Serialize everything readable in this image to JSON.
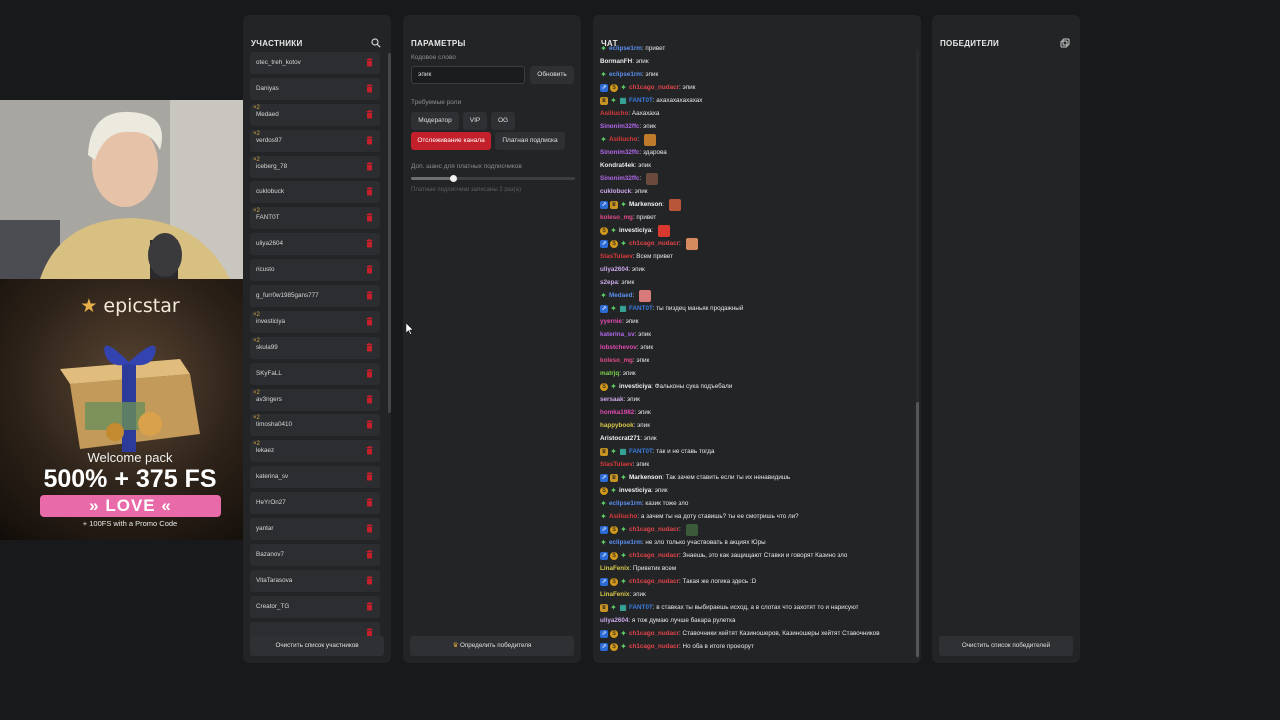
{
  "participants": {
    "title": "УЧАСТНИКИ",
    "list": [
      {
        "name": "otec_treh_kotov",
        "bonus": ""
      },
      {
        "name": "Daniyas",
        "bonus": ""
      },
      {
        "name": "Medaed",
        "bonus": "×2"
      },
      {
        "name": "verdos97",
        "bonus": "×2"
      },
      {
        "name": "iceberg_78",
        "bonus": "×2"
      },
      {
        "name": "cuklobuck",
        "bonus": ""
      },
      {
        "name": "FANT0T",
        "bonus": "×2"
      },
      {
        "name": "uliya2604",
        "bonus": ""
      },
      {
        "name": "ricusto",
        "bonus": ""
      },
      {
        "name": "g_furr0w1985gans777",
        "bonus": ""
      },
      {
        "name": "investiciya",
        "bonus": "×2"
      },
      {
        "name": "skula99",
        "bonus": "×2"
      },
      {
        "name": "SKyFaLL",
        "bonus": ""
      },
      {
        "name": "av3ngers",
        "bonus": "×2"
      },
      {
        "name": "timosha0410",
        "bonus": "×2"
      },
      {
        "name": "lekaez",
        "bonus": "×2"
      },
      {
        "name": "katerina_sv",
        "bonus": ""
      },
      {
        "name": "HeYrOn27",
        "bonus": ""
      },
      {
        "name": "yantar",
        "bonus": ""
      },
      {
        "name": "Bazanov7",
        "bonus": ""
      },
      {
        "name": "VitaTarasova",
        "bonus": ""
      },
      {
        "name": "Creator_TG",
        "bonus": ""
      },
      {
        "name": "",
        "bonus": ""
      }
    ],
    "clear_label": "Очистить список участников"
  },
  "params": {
    "title": "ПАРАМЕТРЫ",
    "keyword_label": "Кодовое слово",
    "keyword_value": "эпик",
    "update_label": "Обновить",
    "roles_label": "Требуемые роли",
    "roles": [
      "Модератор",
      "VIP",
      "OG"
    ],
    "follow_label": "Отслеживание канала",
    "sub_label": "Платная подписка",
    "chance_label": "Доп. шанс для платных подписчиков",
    "chance_value": 0.26,
    "chance_note": "Платные подписчики записаны 2 раз(а)",
    "determine_label": "Определить победителя"
  },
  "chat": {
    "title": "ЧАТ",
    "messages": [
      {
        "badges": [
          "sparkle"
        ],
        "user": "eclipse1rm",
        "color": "#5b8ff0",
        "text": "привет",
        "emote": ""
      },
      {
        "badges": [],
        "user": "BormanFH",
        "color": "#e8e8e8",
        "text": "эпик",
        "emote": ""
      },
      {
        "badges": [
          "sparkle"
        ],
        "user": "eclipse1rm",
        "color": "#5b8ff0",
        "text": "эпик",
        "emote": ""
      },
      {
        "badges": [
          "arrow",
          "coin",
          "sparkle"
        ],
        "user": "ch1cago_nudacr",
        "color": "#e0454b",
        "text": "эпик",
        "emote": ""
      },
      {
        "badges": [
          "crown",
          "sparkle",
          "gift"
        ],
        "user": "FANT0T",
        "color": "#3b7be0",
        "text": "ахахахахахахах",
        "emote": ""
      },
      {
        "badges": [],
        "user": "Asiliucho",
        "color": "#d83a3a",
        "text": "Аахахаха",
        "emote": ""
      },
      {
        "badges": [],
        "user": "Sinonim32ffc",
        "color": "#b068e8",
        "text": "эпик",
        "emote": ""
      },
      {
        "badges": [
          "sparkle"
        ],
        "user": "Asiliucho",
        "color": "#d83a3a",
        "text": "",
        "emote": "#c07a2c"
      },
      {
        "badges": [],
        "user": "Sinonim32ffc",
        "color": "#b068e8",
        "text": "здарова",
        "emote": ""
      },
      {
        "badges": [],
        "user": "Kondrat4ek",
        "color": "#e8e8e8",
        "text": "эпик",
        "emote": ""
      },
      {
        "badges": [],
        "user": "Sinonim32ffc",
        "color": "#b068e8",
        "text": "",
        "emote": "#6a4a3a"
      },
      {
        "badges": [],
        "user": "cuklobuck",
        "color": "#c9a7e8",
        "text": "эпик",
        "emote": ""
      },
      {
        "badges": [
          "arrow",
          "crown",
          "sparkle"
        ],
        "user": "Markenson",
        "color": "#f2f2f2",
        "text": "",
        "emote": "#b8563a"
      },
      {
        "badges": [],
        "user": "koleso_mg",
        "color": "#e04a8a",
        "text": "привет",
        "emote": ""
      },
      {
        "badges": [
          "coin",
          "sparkle"
        ],
        "user": "investiciya",
        "color": "#f2f2f2",
        "text": "",
        "emote": "#d9392f"
      },
      {
        "badges": [
          "arrow",
          "coin",
          "sparkle"
        ],
        "user": "ch1cago_nudacr",
        "color": "#e0454b",
        "text": "",
        "emote": "#d48a5c"
      },
      {
        "badges": [],
        "user": "StasTulaev",
        "color": "#d83a3a",
        "text": "Всем привет",
        "emote": ""
      },
      {
        "badges": [],
        "user": "uliya2604",
        "color": "#c9a7e8",
        "text": "эпик",
        "emote": ""
      },
      {
        "badges": [],
        "user": "s2epa",
        "color": "#c9a7e8",
        "text": "эпик",
        "emote": ""
      },
      {
        "badges": [
          "sparkle"
        ],
        "user": "Medaed",
        "color": "#5b8ff0",
        "text": "",
        "emote": "#d97a7a"
      },
      {
        "badges": [
          "arrow",
          "sparkle",
          "gift"
        ],
        "user": "FANT0T",
        "color": "#3b7be0",
        "text": "ты пиздец маньяк продажный",
        "emote": ""
      },
      {
        "badges": [],
        "user": "yyernie",
        "color": "#e04ab0",
        "text": "эпик",
        "emote": ""
      },
      {
        "badges": [],
        "user": "katerina_sv",
        "color": "#b068e8",
        "text": "эпик",
        "emote": ""
      },
      {
        "badges": [],
        "user": "lobstchevov",
        "color": "#e04ab0",
        "text": "эпик",
        "emote": ""
      },
      {
        "badges": [],
        "user": "koleso_mg",
        "color": "#e04a8a",
        "text": "эпик",
        "emote": ""
      },
      {
        "badges": [],
        "user": "matrjq",
        "color": "#7ccf4a",
        "text": "эпик",
        "emote": ""
      },
      {
        "badges": [
          "coin",
          "sparkle"
        ],
        "user": "investiciya",
        "color": "#f2f2f2",
        "text": "Фальконы сука подъебали",
        "emote": ""
      },
      {
        "badges": [],
        "user": "sersaak",
        "color": "#c9a7e8",
        "text": "эпик",
        "emote": ""
      },
      {
        "badges": [],
        "user": "homka1982",
        "color": "#e04ab0",
        "text": "эпик",
        "emote": ""
      },
      {
        "badges": [],
        "user": "happybook",
        "color": "#d8c84a",
        "text": "эпик",
        "emote": ""
      },
      {
        "badges": [],
        "user": "Aristocrat271",
        "color": "#f2f2f2",
        "text": "эпик",
        "emote": ""
      },
      {
        "badges": [
          "crown",
          "sparkle",
          "gift"
        ],
        "user": "FANT0T",
        "color": "#3b7be0",
        "text": "так и не ставь тогда",
        "emote": ""
      },
      {
        "badges": [],
        "user": "StasTulaev",
        "color": "#d83a3a",
        "text": "эпик",
        "emote": ""
      },
      {
        "badges": [
          "arrow",
          "crown",
          "sparkle"
        ],
        "user": "Markenson",
        "color": "#f2f2f2",
        "text": "Так зачем ставить если ты их ненавидишь",
        "emote": ""
      },
      {
        "badges": [
          "coin",
          "sparkle"
        ],
        "user": "investiciya",
        "color": "#f2f2f2",
        "text": "эпик",
        "emote": ""
      },
      {
        "badges": [
          "sparkle"
        ],
        "user": "eclipse1rm",
        "color": "#5b8ff0",
        "text": "казик тоже зло",
        "emote": ""
      },
      {
        "badges": [
          "sparkle"
        ],
        "user": "Asiliucho",
        "color": "#d83a3a",
        "text": "а зачем ты на доту ставишь? ты ее смотришь что ли?",
        "emote": ""
      },
      {
        "badges": [
          "arrow",
          "coin",
          "sparkle"
        ],
        "user": "ch1cago_nudacr",
        "color": "#e0454b",
        "text": "",
        "emote": "#3a5a3a"
      },
      {
        "badges": [
          "sparkle"
        ],
        "user": "eclipse1rm",
        "color": "#5b8ff0",
        "text": "не зло только участвовать в акциях Юры",
        "emote": ""
      },
      {
        "badges": [
          "arrow",
          "coin",
          "sparkle"
        ],
        "user": "ch1cago_nudacr",
        "color": "#e0454b",
        "text": "Знаешь, это как защищают Ставки и говорят Казино зло",
        "emote": ""
      },
      {
        "badges": [],
        "user": "LinaFenix",
        "color": "#d8c84a",
        "text": "Приветик всем",
        "emote": ""
      },
      {
        "badges": [
          "arrow",
          "coin",
          "sparkle"
        ],
        "user": "ch1cago_nudacr",
        "color": "#e0454b",
        "text": "Такая же логика здесь :D",
        "emote": ""
      },
      {
        "badges": [],
        "user": "LinaFenix",
        "color": "#d8c84a",
        "text": "эпик",
        "emote": ""
      },
      {
        "badges": [
          "crown",
          "sparkle",
          "gift"
        ],
        "user": "FANT0T",
        "color": "#3b7be0",
        "text": "в ставках ты выбираешь исход, а в слотах что захотят то и нарисуют",
        "emote": ""
      },
      {
        "badges": [],
        "user": "uliya2604",
        "color": "#c9a7e8",
        "text": "я тож думаю лучше бакара рулетка",
        "emote": ""
      },
      {
        "badges": [
          "arrow",
          "coin",
          "sparkle"
        ],
        "user": "ch1cago_nudacr",
        "color": "#e0454b",
        "text": "Ставочники хейтят Казиношеров, Казиношеры хейтят Ставочников",
        "emote": ""
      },
      {
        "badges": [
          "arrow",
          "coin",
          "sparkle"
        ],
        "user": "ch1cago_nudacr",
        "color": "#e0454b",
        "text": "Но оба в итоге проеорут",
        "emote": ""
      }
    ]
  },
  "winners": {
    "title": "ПОБЕДИТЕЛИ",
    "clear_label": "Очистить список победителей"
  },
  "ad": {
    "brand": "epicstar",
    "welcome": "Welcome pack",
    "amount": "500% + 375 FS",
    "code": "» LOVE «",
    "promo": "+ 100FS with a Promo Code"
  },
  "colors": {
    "accent_red": "#c3202b",
    "panel": "#232426",
    "background": "#18191b"
  }
}
